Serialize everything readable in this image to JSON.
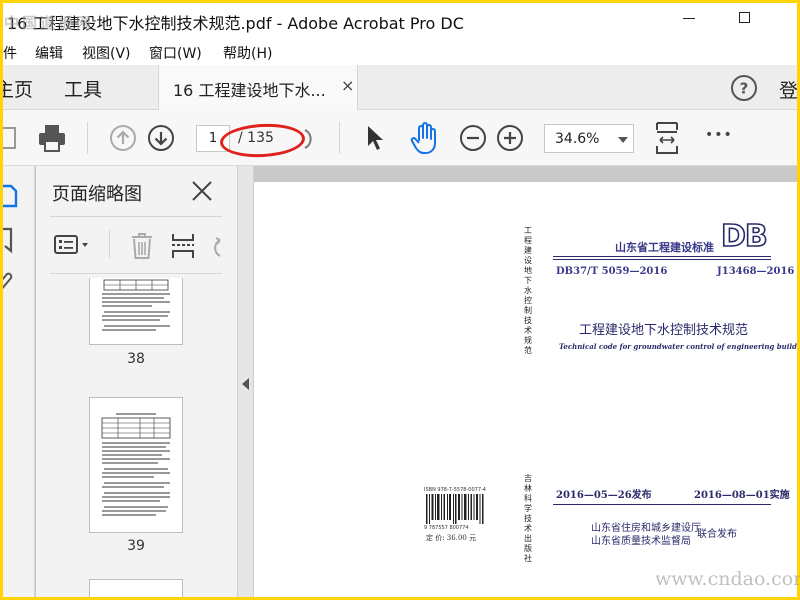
{
  "window": {
    "title": "16 工程建设地下水控制技术规范.pdf - Adobe Acrobat Pro DC"
  },
  "menu": {
    "items": [
      "件",
      "编辑",
      "视图(V)",
      "窗口(W)",
      "帮助(H)"
    ]
  },
  "tabs": {
    "home": "主页",
    "tools": "工具",
    "document": "16 工程建设地下水...",
    "close_glyph": "×",
    "login": "登"
  },
  "toolbar": {
    "current_page": "1",
    "page_total": "/ 135",
    "zoom": "34.6%",
    "more_glyph": "•••"
  },
  "thumbnails_panel": {
    "title": "页面缩略图",
    "pages": [
      {
        "label": "38"
      },
      {
        "label": "39"
      }
    ]
  },
  "document": {
    "side_text_top": "工程建设地下水控制技术规范",
    "standard_label": "山东省工程建设标准",
    "logo": "DB",
    "code_left": "DB37/T 5059—2016",
    "code_right": "J13468—2016",
    "title_cn": "工程建设地下水控制技术规范",
    "title_en": "Technical code for groundwater control of engineering buildings",
    "date_issue": "2016—05—26发布",
    "date_effective": "2016—08—01实施",
    "issuer_1": "山东省住房和城乡建设厅",
    "issuer_2": "山东省质量技术监督局",
    "joint_release": "联合发布",
    "side_text_bottom": "吉林科学技术出版社",
    "barcode_top": "ISBN 978-7-5578-0077-4",
    "barcode_number": "9 787557 800774",
    "price": "定 价: 36.00 元"
  },
  "watermark": {
    "top_left": "中国道板网",
    "bottom_right": "www.cndao.com"
  },
  "colors": {
    "frame": "#ffd400",
    "active_tool_blue": "#1473e6",
    "annotation_red": "#e0201b",
    "doc_ink": "#2a2a6a"
  }
}
